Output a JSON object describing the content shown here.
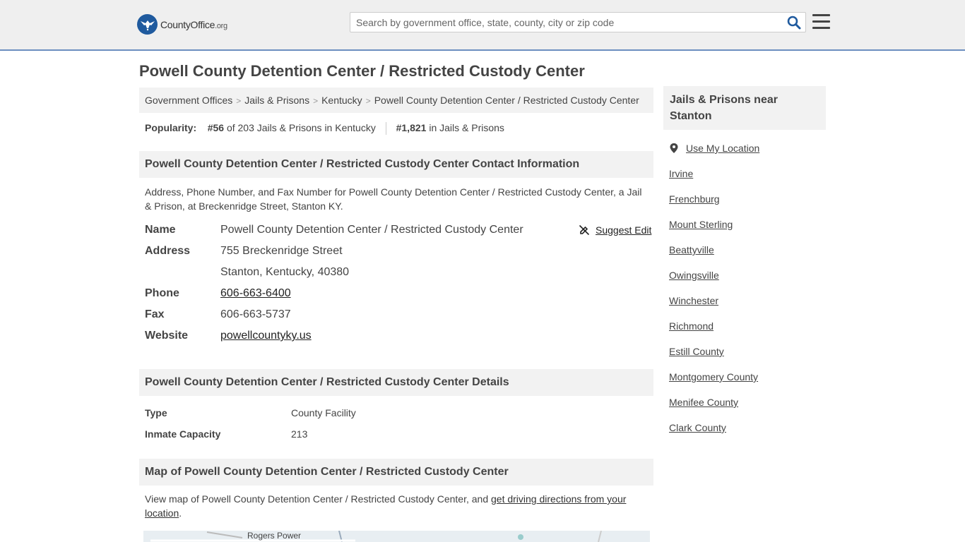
{
  "header": {
    "logo_main": "CountyOffice",
    "logo_suffix": ".org",
    "search_placeholder": "Search by government office, state, county, city or zip code"
  },
  "page_title": "Powell County Detention Center / Restricted Custody Center",
  "breadcrumb": [
    "Government Offices",
    "Jails & Prisons",
    "Kentucky",
    "Powell County Detention Center / Restricted Custody Center"
  ],
  "popularity": {
    "label": "Popularity:",
    "state_rank": "#56",
    "state_text": "of 203 Jails & Prisons in Kentucky",
    "national_rank": "#1,821",
    "national_text": "in Jails & Prisons"
  },
  "contact": {
    "heading": "Powell County Detention Center / Restricted Custody Center Contact Information",
    "description": "Address, Phone Number, and Fax Number for Powell County Detention Center / Restricted Custody Center, a Jail & Prison, at Breckenridge Street, Stanton KY.",
    "suggest_edit": "Suggest Edit",
    "rows": {
      "name_label": "Name",
      "name_value": "Powell County Detention Center / Restricted Custody Center",
      "address_label": "Address",
      "address_line1": "755 Breckenridge Street",
      "address_line2": "Stanton, Kentucky, 40380",
      "phone_label": "Phone",
      "phone_value": "606-663-6400",
      "fax_label": "Fax",
      "fax_value": "606-663-5737",
      "website_label": "Website",
      "website_value": "powellcountyky.us"
    }
  },
  "details": {
    "heading": "Powell County Detention Center / Restricted Custody Center Details",
    "type_label": "Type",
    "type_value": "County Facility",
    "capacity_label": "Inmate Capacity",
    "capacity_value": "213"
  },
  "map": {
    "heading": "Map of Powell County Detention Center / Restricted Custody Center",
    "desc_prefix": "View map of Powell County Detention Center / Restricted Custody Center, and ",
    "desc_link": "get driving directions from your location",
    "desc_suffix": ".",
    "label": "Rogers Power"
  },
  "sidebar": {
    "heading": "Jails & Prisons near Stanton",
    "use_location": "Use My Location",
    "items": [
      "Irvine",
      "Frenchburg",
      "Mount Sterling",
      "Beattyville",
      "Owingsville",
      "Winchester",
      "Richmond",
      "Estill County",
      "Montgomery County",
      "Menifee County",
      "Clark County"
    ]
  }
}
